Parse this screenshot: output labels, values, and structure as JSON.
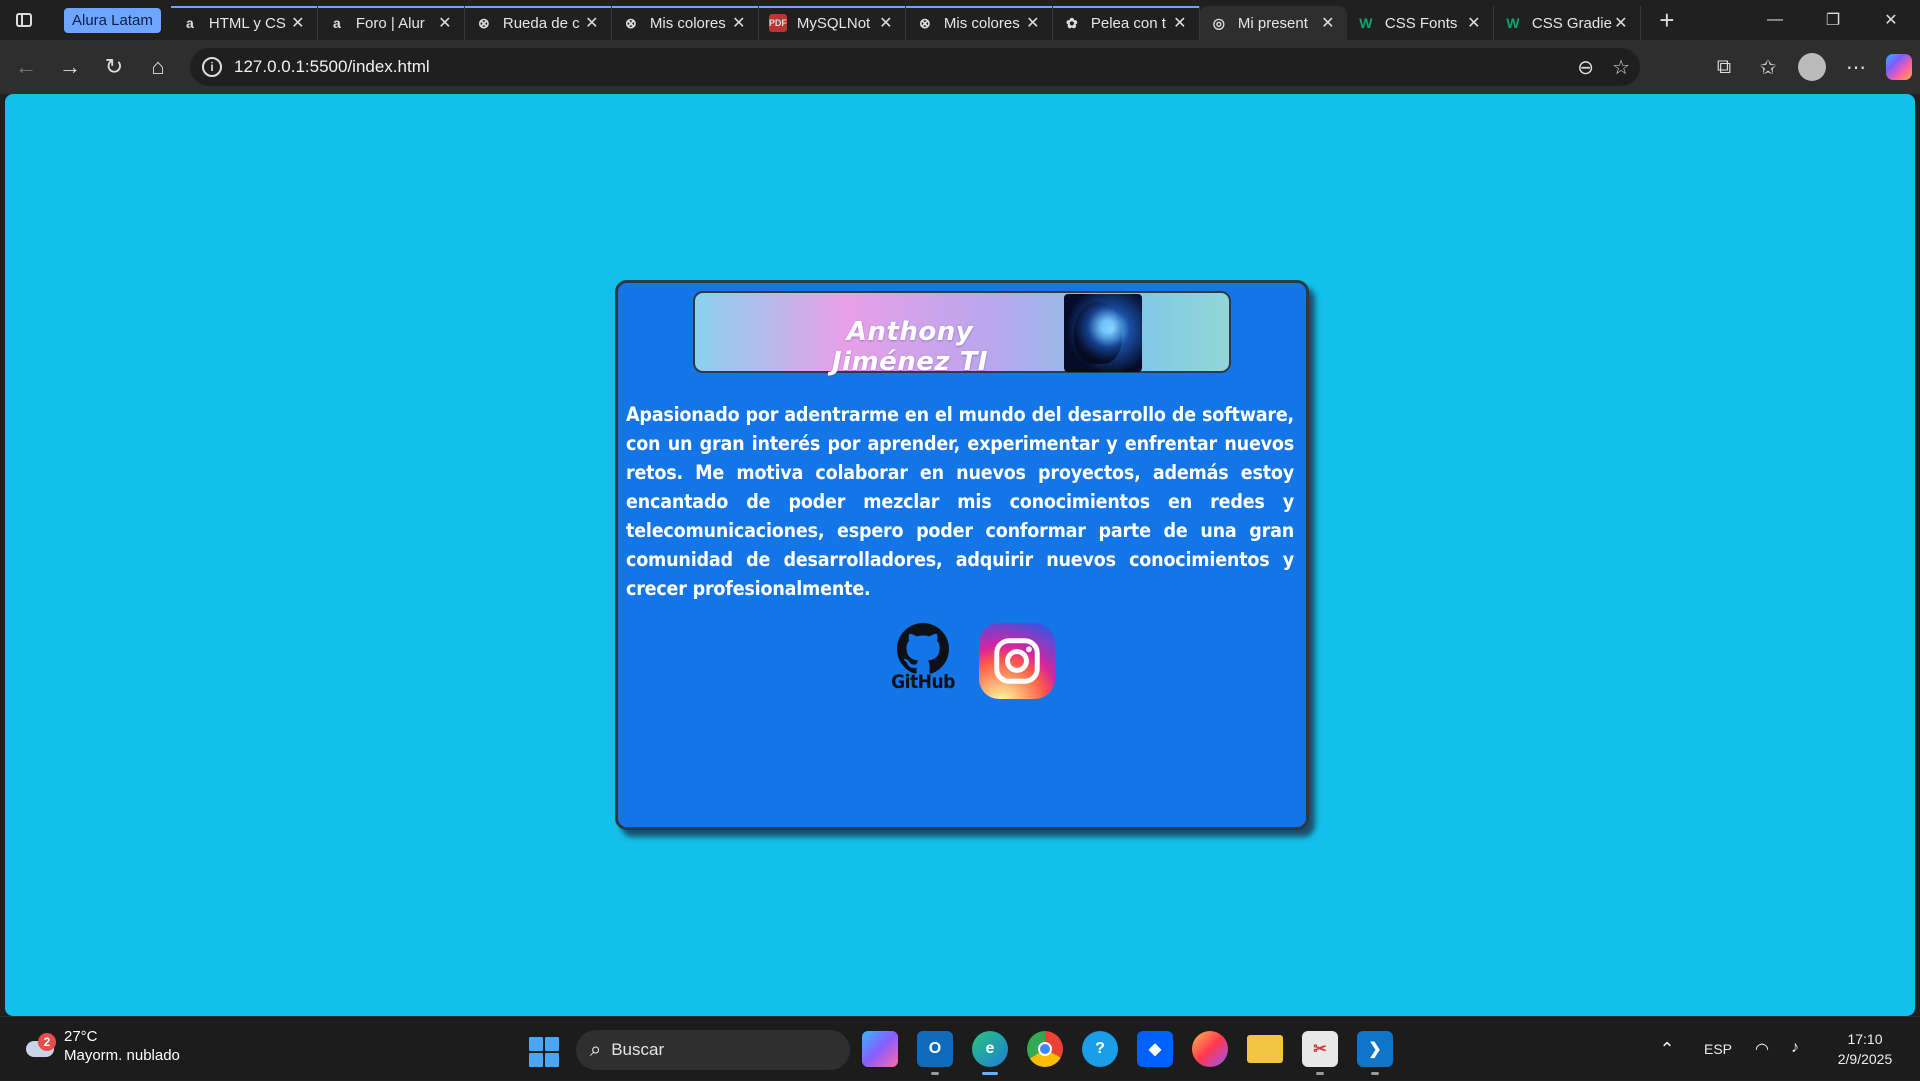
{
  "browser": {
    "tab_group_label": "Alura Latam",
    "tabs": [
      {
        "label": "HTML y CS",
        "favicon": "alura-icon",
        "grouped": true
      },
      {
        "label": "Foro | Alur",
        "favicon": "alura-icon",
        "grouped": true
      },
      {
        "label": "Rueda de c",
        "favicon": "colorwheel-icon",
        "grouped": true
      },
      {
        "label": "Mis colores",
        "favicon": "colorwheel-icon",
        "grouped": true
      },
      {
        "label": "MySQLNot",
        "favicon": "pdf-icon",
        "grouped": true
      },
      {
        "label": "Mis colores",
        "favicon": "colorwheel-icon",
        "grouped": true
      },
      {
        "label": "Pelea con t",
        "favicon": "chatgpt-icon",
        "grouped": true
      },
      {
        "label": "Mi present",
        "favicon": "globe-icon",
        "grouped": false,
        "active": true
      },
      {
        "label": "CSS Fonts",
        "favicon": "w3schools-icon",
        "grouped": false
      },
      {
        "label": "CSS Gradie",
        "favicon": "w3schools-icon",
        "grouped": false
      }
    ],
    "url": "127.0.0.1:5500/index.html"
  },
  "page": {
    "banner_title": "Anthony Jiménez TI",
    "about_text": "Apasionado por adentrarme en el mundo del desarrollo de software, con un gran interés por aprender, experimentar y enfrentar nuevos retos. Me motiva colaborar en nuevos proyectos, además estoy encantado de poder mezclar mis conocimientos en redes y telecomunicaciones, espero poder conformar parte de una gran comunidad de desarrolladores, adquirir nuevos conocimientos y crecer profesionalmente.",
    "github_label": "GitHub",
    "colors": {
      "background": "#12c0ea",
      "card": "#1476e6",
      "card_border": "#2b3845"
    }
  },
  "taskbar": {
    "weather": {
      "temp": "27°C",
      "condition": "Mayorm. nublado",
      "badge": "2"
    },
    "search_placeholder": "Buscar",
    "apps": [
      "copilot-icon",
      "outlook-icon",
      "edge-icon",
      "chrome-icon",
      "help-icon",
      "dropbox-icon",
      "firefox-icon",
      "file-explorer-icon",
      "snipping-tool-icon",
      "vscode-icon"
    ],
    "language": "ESP",
    "time": "17:10",
    "date": "2/9/2025"
  }
}
